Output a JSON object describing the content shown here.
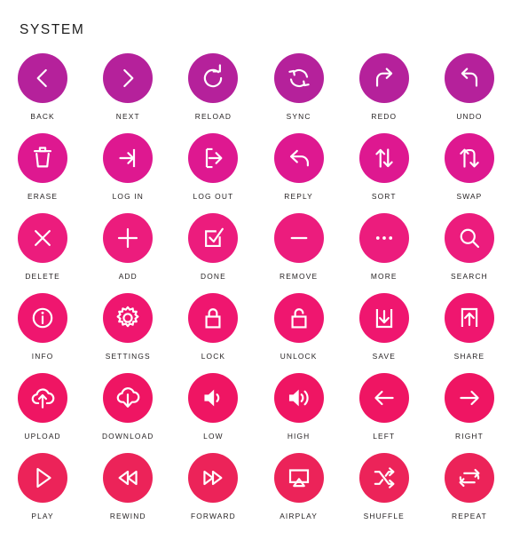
{
  "header": {
    "title": "SYSTEM"
  },
  "palette": {
    "background": "#ffffff",
    "label_color": "#231f20",
    "icon_color": "#ffffff",
    "row_colors": [
      "#B5219B",
      "#DE1890",
      "#EC1C7D",
      "#EF166F",
      "#EF1563",
      "#EC2359"
    ]
  },
  "rows": [
    {
      "color": "#B5219B",
      "items": [
        {
          "label": "BACK",
          "icon": "chevron-left-icon"
        },
        {
          "label": "NEXT",
          "icon": "chevron-right-icon"
        },
        {
          "label": "RELOAD",
          "icon": "reload-icon"
        },
        {
          "label": "SYNC",
          "icon": "sync-icon"
        },
        {
          "label": "REDO",
          "icon": "redo-icon"
        },
        {
          "label": "UNDO",
          "icon": "undo-icon"
        }
      ]
    },
    {
      "color": "#DE1890",
      "items": [
        {
          "label": "ERASE",
          "icon": "trash-icon"
        },
        {
          "label": "LOG IN",
          "icon": "log-in-icon"
        },
        {
          "label": "LOG OUT",
          "icon": "log-out-icon"
        },
        {
          "label": "REPLY",
          "icon": "reply-icon"
        },
        {
          "label": "SORT",
          "icon": "sort-icon"
        },
        {
          "label": "SWAP",
          "icon": "swap-icon"
        }
      ]
    },
    {
      "color": "#EC1C7D",
      "items": [
        {
          "label": "DELETE",
          "icon": "close-icon"
        },
        {
          "label": "ADD",
          "icon": "plus-icon"
        },
        {
          "label": "DONE",
          "icon": "checkbox-check-icon"
        },
        {
          "label": "REMOVE",
          "icon": "minus-icon"
        },
        {
          "label": "MORE",
          "icon": "ellipsis-icon"
        },
        {
          "label": "SEARCH",
          "icon": "search-icon"
        }
      ]
    },
    {
      "color": "#EF166F",
      "items": [
        {
          "label": "INFO",
          "icon": "info-icon"
        },
        {
          "label": "SETTINGS",
          "icon": "gear-icon"
        },
        {
          "label": "LOCK",
          "icon": "lock-closed-icon"
        },
        {
          "label": "UNLOCK",
          "icon": "lock-open-icon"
        },
        {
          "label": "SAVE",
          "icon": "save-download-tray-icon"
        },
        {
          "label": "SHARE",
          "icon": "share-upload-tray-icon"
        }
      ]
    },
    {
      "color": "#EF1563",
      "items": [
        {
          "label": "UPLOAD",
          "icon": "cloud-upload-icon"
        },
        {
          "label": "DOWNLOAD",
          "icon": "cloud-download-icon"
        },
        {
          "label": "LOW",
          "icon": "volume-low-icon"
        },
        {
          "label": "HIGH",
          "icon": "volume-high-icon"
        },
        {
          "label": "LEFT",
          "icon": "arrow-left-icon"
        },
        {
          "label": "RIGHT",
          "icon": "arrow-right-icon"
        }
      ]
    },
    {
      "color": "#EC2359",
      "items": [
        {
          "label": "PLAY",
          "icon": "play-icon"
        },
        {
          "label": "REWIND",
          "icon": "rewind-icon"
        },
        {
          "label": "FORWARD",
          "icon": "fast-forward-icon"
        },
        {
          "label": "AIRPLAY",
          "icon": "airplay-icon"
        },
        {
          "label": "SHUFFLE",
          "icon": "shuffle-icon"
        },
        {
          "label": "REPEAT",
          "icon": "repeat-icon"
        }
      ]
    }
  ]
}
